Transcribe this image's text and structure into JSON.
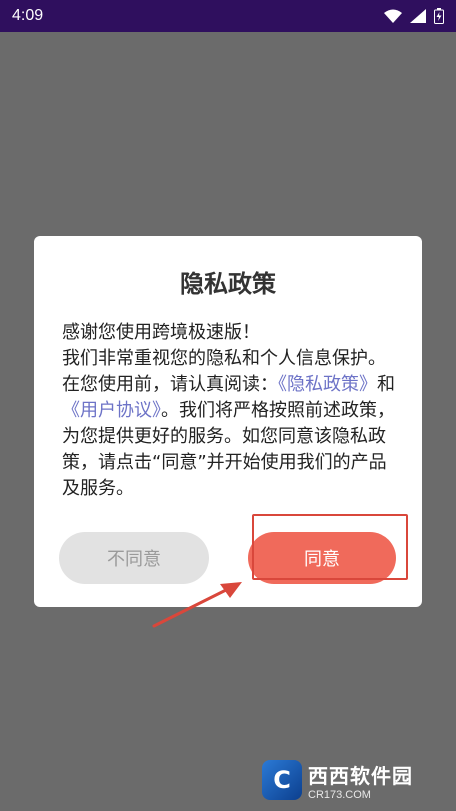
{
  "status_bar": {
    "time": "4:09",
    "icons": [
      "wifi-icon",
      "signal-icon",
      "battery-icon"
    ]
  },
  "dialog": {
    "title": "隐私政策",
    "body": {
      "line1": "感谢您使用跨境极速版！",
      "line2": "我们非常重视您的隐私和个人信息保护。在您使用前，请认真阅读：",
      "privacy_link": "《隐私政策》",
      "and": "和",
      "agreement_link": "《用户协议》",
      "line3": "。我们将严格按照前述政策，为您提供更好的服务。如您同意该隐私政策，请点击“同意”并开始使用我们的产品及服务。"
    },
    "buttons": {
      "disagree": "不同意",
      "agree": "同意"
    }
  },
  "watermark": {
    "text": "西西软件园",
    "sub": "CR173.COM"
  },
  "colors": {
    "status_bar": "#2f0f5e",
    "overlay": "#6b6b6b",
    "agree_button": "#f06a5b",
    "disagree_button": "#e2e2e2",
    "link": "#6d73c7",
    "annotation": "#d9473b"
  }
}
